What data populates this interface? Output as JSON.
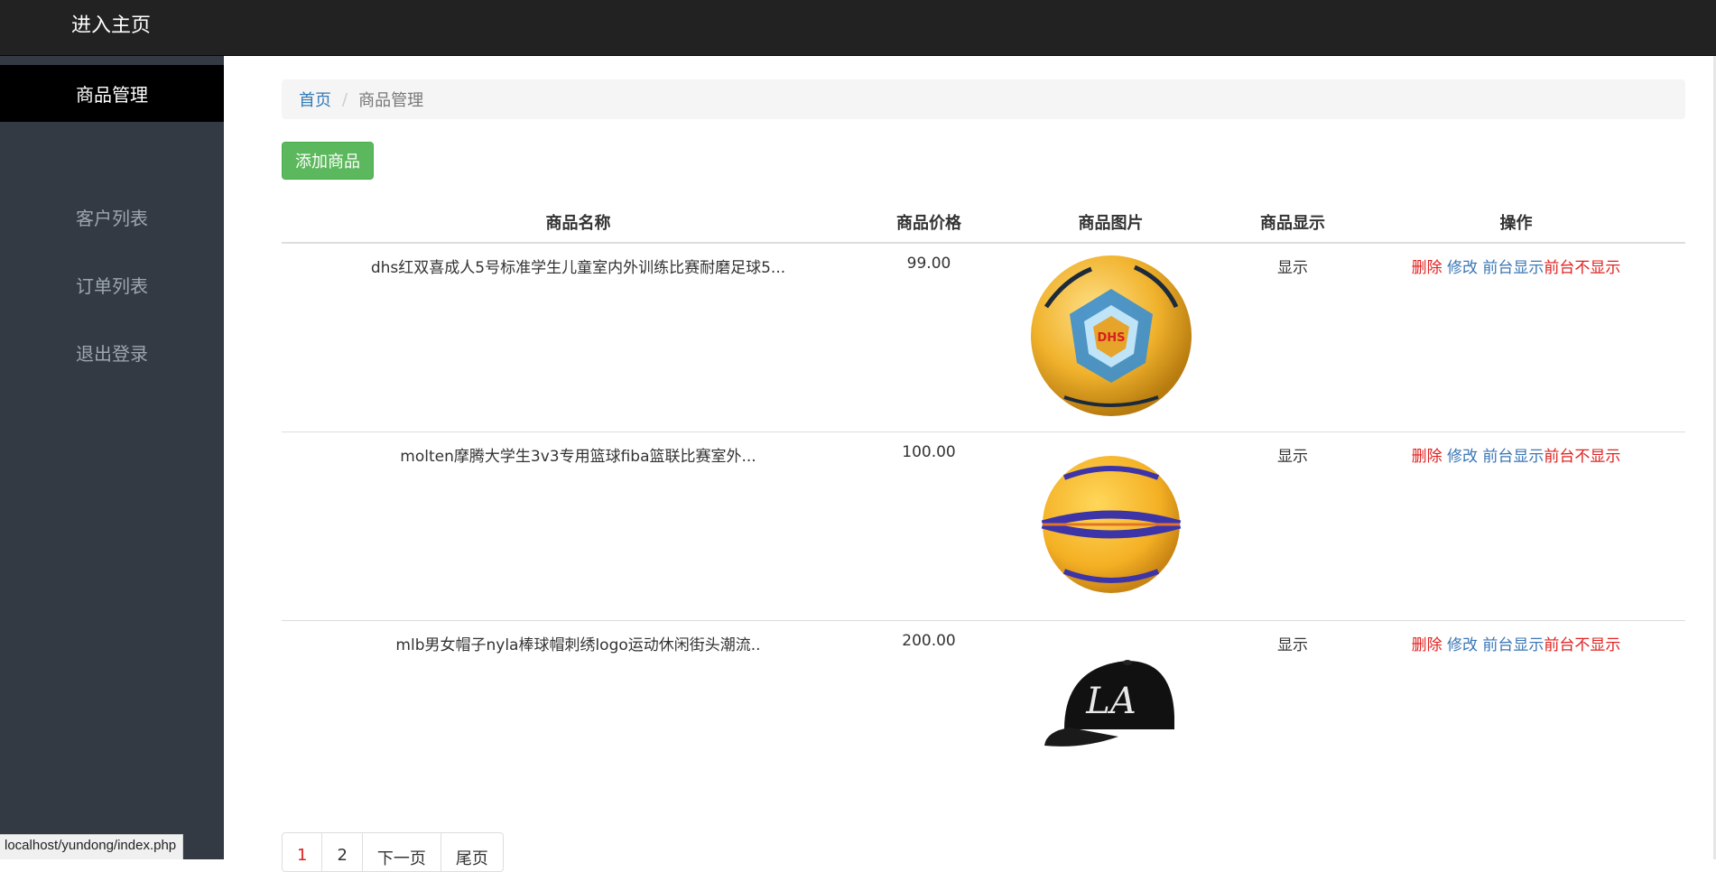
{
  "navbar": {
    "brand": "进入主页"
  },
  "sidebar": {
    "items": [
      {
        "label": "商品管理",
        "active": true
      },
      {
        "label": "客户列表",
        "active": false
      },
      {
        "label": "订单列表",
        "active": false
      },
      {
        "label": "退出登录",
        "active": false
      }
    ]
  },
  "breadcrumb": {
    "home": "首页",
    "separator": "/",
    "current": "商品管理"
  },
  "toolbar": {
    "add_label": "添加商品"
  },
  "table": {
    "headers": [
      "商品名称",
      "商品价格",
      "商品图片",
      "商品显示",
      "操作"
    ],
    "rows": [
      {
        "name": "dhs红双喜成人5号标准学生儿童室内外训练比赛耐磨足球5...",
        "price": "99.00",
        "image_icon": "soccer-ball-image",
        "display": "显示",
        "ops": {
          "delete": "删除",
          "edit": "修改",
          "show_front": "前台显示",
          "hide_front": "前台不显示"
        }
      },
      {
        "name": "molten摩腾大学生3v3专用篮球fiba篮联比赛室外...",
        "price": "100.00",
        "image_icon": "basketball-image",
        "display": "显示",
        "ops": {
          "delete": "删除",
          "edit": "修改",
          "show_front": "前台显示",
          "hide_front": "前台不显示"
        }
      },
      {
        "name": "mlb男女帽子nyla棒球帽刺绣logo运动休闲街头潮流..",
        "price": "200.00",
        "image_icon": "baseball-cap-image",
        "display": "显示",
        "ops": {
          "delete": "删除",
          "edit": "修改",
          "show_front": "前台显示",
          "hide_front": "前台不显示"
        }
      }
    ]
  },
  "pagination": {
    "pages": [
      "1",
      "2"
    ],
    "next": "下一页",
    "last": "尾页",
    "current": "1"
  },
  "status_bar": {
    "url": "localhost/yundong/index.php"
  },
  "colors": {
    "danger": "#e0211f",
    "link": "#3a76b5",
    "success": "#5cb85c",
    "sidebar": "#333a43",
    "navbar": "#222222"
  }
}
